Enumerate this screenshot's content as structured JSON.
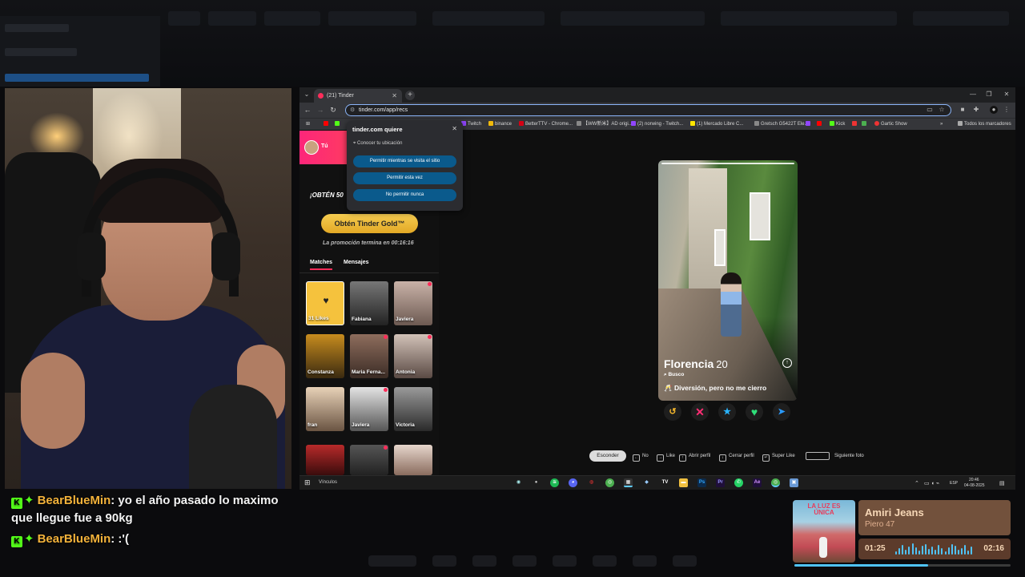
{
  "browser": {
    "tab_title": "(21) Tinder",
    "url": "tinder.com/app/recs",
    "bookmarks": [
      "Twitch",
      "binance",
      "BetterTTV - Chrome...",
      "【WW新米】AD origi...",
      "(2) norwing - Twitch...",
      "(1) Mercado Libre C...",
      "Gretsch G5422T Ele...",
      "Kick",
      "Gartic Show",
      "Todos los marcadores"
    ]
  },
  "permission_popup": {
    "title": "tinder.com quiere",
    "request": "Conocer tu ubicación",
    "buttons": [
      "Permitir mientras se visita el sitio",
      "Permitir esta vez",
      "No permitir nunca"
    ]
  },
  "sidebar": {
    "user_label": "Tú",
    "promo_text": "¡OBTÉN 50",
    "gold_button": "Obtén Tinder Gold™",
    "promo_timer": "La promoción termina en 00:16:16",
    "tabs": [
      "Matches",
      "Mensajes"
    ],
    "likes_label": "31 Likes",
    "matches": [
      "Fabiana",
      "Javiera",
      "Constanza",
      "Maria Ferna...",
      "Antonia",
      "fran",
      "Javiera",
      "Victoria"
    ]
  },
  "card": {
    "name": "Florencia",
    "age": "20",
    "seeking": "Busco",
    "intent": "Diversión, pero no me cierro"
  },
  "shortcuts": {
    "hide": "Esconder",
    "items": [
      "No",
      "Like",
      "Abrir perfil",
      "Cerrar perfil",
      "Super Like",
      "Siguiente foto"
    ]
  },
  "taskbar": {
    "links": "Vínculos",
    "lang": "ESP",
    "time": "20:46",
    "date": "04-08-2025"
  },
  "chat": [
    {
      "user": "BearBlueMin",
      "message": ": yo el año pasado lo maximo que llegue fue a 90kg"
    },
    {
      "user": "BearBlueMin",
      "message": ": :'("
    }
  ],
  "music": {
    "album_text": "LA LUZ ES ÚNICA",
    "title": "Amiri Jeans",
    "artist": "Piero 47",
    "current": "01:25",
    "total": "02:16",
    "progress": 0.62
  },
  "colors": {
    "tinder_pink": "#fd267a",
    "gold": "#f5cc50",
    "kick_green": "#53fc18",
    "accent_blue": "#4fc3f7"
  }
}
